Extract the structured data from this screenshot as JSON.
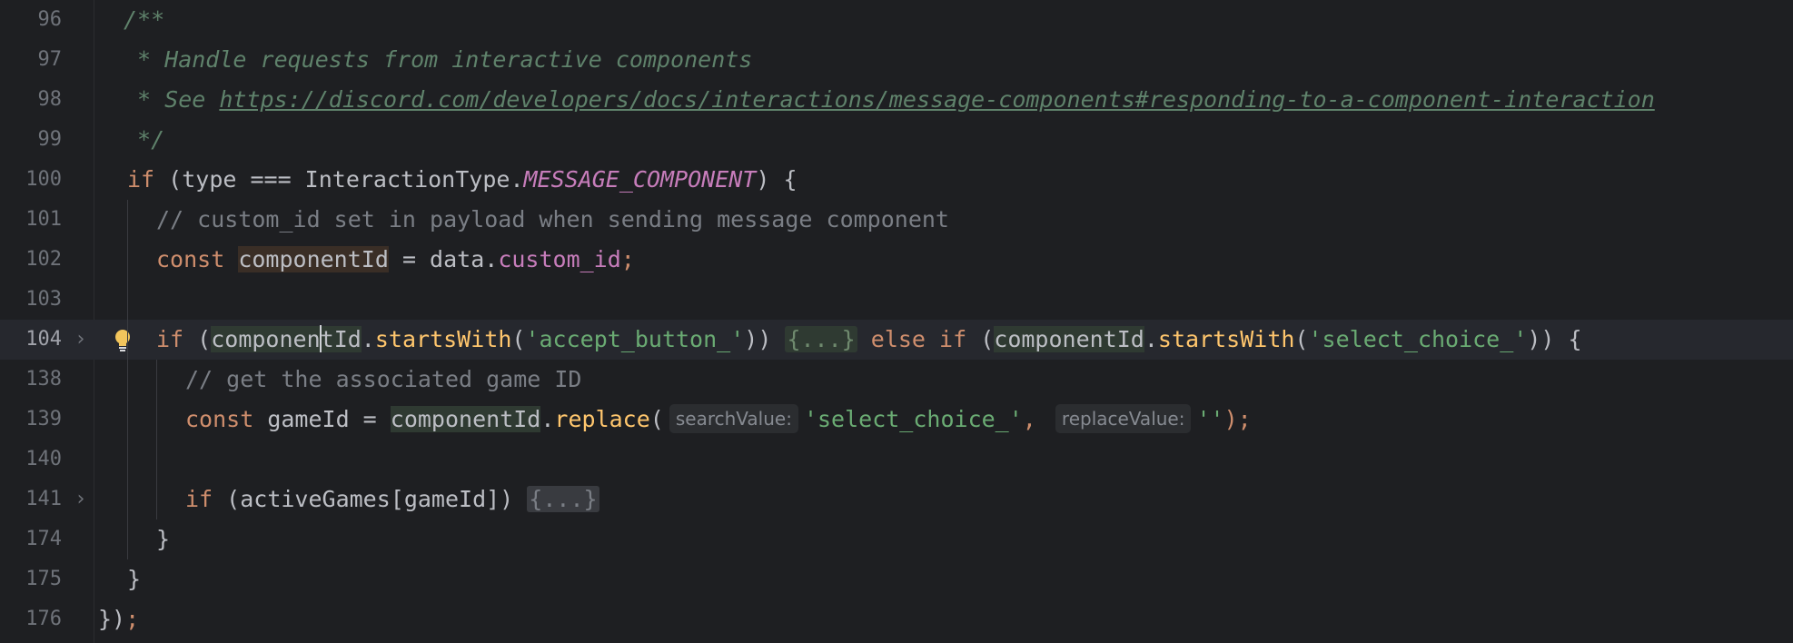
{
  "editor": {
    "lines": [
      {
        "num": "96"
      },
      {
        "num": "97"
      },
      {
        "num": "98"
      },
      {
        "num": "99"
      },
      {
        "num": "100"
      },
      {
        "num": "101"
      },
      {
        "num": "102"
      },
      {
        "num": "103"
      },
      {
        "num": "104"
      },
      {
        "num": "138"
      },
      {
        "num": "139"
      },
      {
        "num": "140"
      },
      {
        "num": "141"
      },
      {
        "num": "174"
      },
      {
        "num": "175"
      },
      {
        "num": "176"
      }
    ],
    "code": {
      "l96": "/**",
      "l97": " * Handle requests from interactive components",
      "l98_prefix": " * See ",
      "l98_link": "https://discord.com/developers/docs/interactions/message-components#responding-to-a-component-interaction",
      "l99": " */",
      "l100_kw": "if",
      "l100_a": " (type === InteractionType.",
      "l100_const": "MESSAGE_COMPONENT",
      "l100_b": ") {",
      "l101": "// custom_id set in payload when sending message component",
      "l102_kw": "const",
      "l102_var": "componentId",
      "l102_a": " = data.",
      "l102_prop": "custom_id",
      "l102_end": ";",
      "l104_kw": "if",
      "l104_a": " (",
      "l104_var1a": "componen",
      "l104_var1b": "tId",
      "l104_dot": ".",
      "l104_fn": "startsWith",
      "l104_p1": "(",
      "l104_str1": "'accept_button_'",
      "l104_p2": "))",
      "l104_fold": "{...}",
      "l104_else": "else",
      "l104_if": "if",
      "l104_b": " (",
      "l104_var2": "componentId",
      "l104_fn2": "startsWith",
      "l104_str2": "'select_choice_'",
      "l104_end": ")) {",
      "l138": "// get the associated game ID",
      "l139_kw": "const",
      "l139_a": " gameId = ",
      "l139_var": "componentId",
      "l139_fn": "replace",
      "l139_hint1": "searchValue:",
      "l139_str1": "'select_choice_'",
      "l139_comma": ",",
      "l139_hint2": "replaceValue:",
      "l139_str2": "''",
      "l139_end": ");",
      "l141_kw": "if",
      "l141_a": " (activeGames[gameId]) ",
      "l141_fold": "{...}",
      "l174": "}",
      "l175": "}",
      "l176_a": "})",
      "l176_semi": ";"
    },
    "icons": {
      "fold_arrow": "chevron-right-icon",
      "intention_bulb": "lightbulb-icon"
    }
  }
}
